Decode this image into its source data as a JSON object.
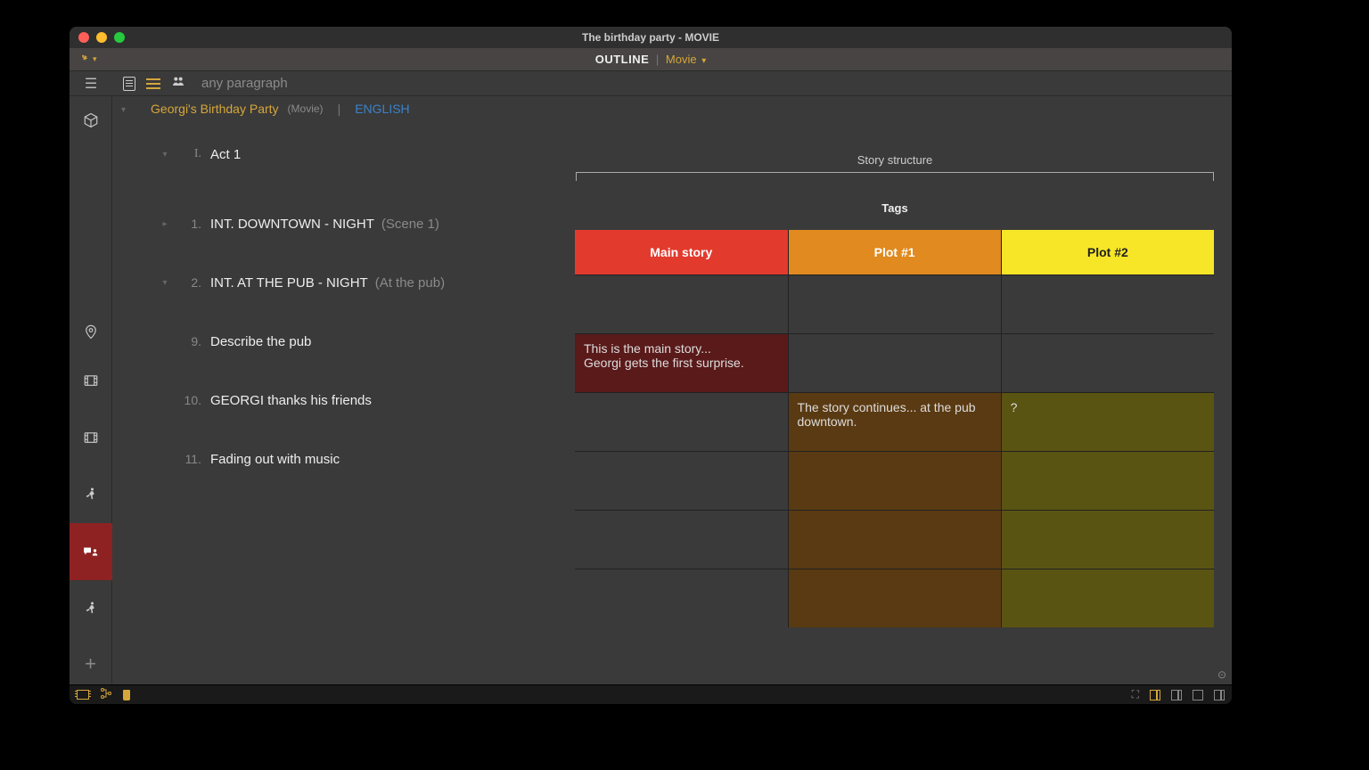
{
  "window": {
    "title": "The birthday party - MOVIE"
  },
  "modebar": {
    "run_icon": "run",
    "mode": "OUTLINE",
    "context": "Movie"
  },
  "toolrow": {
    "search_placeholder": "any paragraph"
  },
  "breadcrumb": {
    "project": "Georgi's Birthday Party",
    "type_label": "(Movie)",
    "separator": "|",
    "language": "ENGLISH"
  },
  "structure_label": "Story structure",
  "tags_label": "Tags",
  "columns": [
    {
      "label": "Main story",
      "color": "#e23b2e"
    },
    {
      "label": "Plot #1",
      "color": "#e08a1f"
    },
    {
      "label": "Plot #2",
      "color": "#f7e627"
    }
  ],
  "rows": [
    {
      "num": "I.",
      "num_style": "roman",
      "chevron": "down",
      "text": "Act 1",
      "suffix": "",
      "cells": [
        "",
        "",
        ""
      ],
      "shades": [
        "",
        "",
        ""
      ]
    },
    {
      "num": "1.",
      "chevron": "right",
      "text": "INT.  DOWNTOWN - NIGHT",
      "suffix": "(Scene 1)",
      "cells": [
        "This is the main story...\nGeorgi gets the first surprise.",
        "",
        ""
      ],
      "shades": [
        "cell-dark-red",
        "",
        ""
      ]
    },
    {
      "num": "2.",
      "chevron": "down",
      "text": "INT.  AT THE PUB - NIGHT",
      "suffix": "(At the pub)",
      "cells": [
        "",
        "The story continues... at the pub downtown.",
        "?"
      ],
      "shades": [
        "",
        "cell-brown",
        "cell-olive"
      ]
    },
    {
      "num": "9.",
      "chevron": "",
      "text": "Describe the pub",
      "suffix": "",
      "cells": [
        "",
        "",
        ""
      ],
      "shades": [
        "",
        "cell-brown",
        "cell-olive"
      ]
    },
    {
      "num": "10.",
      "chevron": "",
      "text": "GEORGI thanks his friends",
      "suffix": "",
      "cells": [
        "",
        "",
        ""
      ],
      "shades": [
        "",
        "cell-brown",
        "cell-olive"
      ]
    },
    {
      "num": "11.",
      "chevron": "",
      "text": "Fading out with music",
      "suffix": "",
      "cells": [
        "",
        "",
        ""
      ],
      "shades": [
        "",
        "cell-brown",
        "cell-olive"
      ]
    }
  ],
  "sidebar": {
    "items": [
      {
        "name": "cube-icon"
      },
      {
        "name": "map-pin-icon"
      },
      {
        "name": "film-icon"
      },
      {
        "name": "film-icon-2"
      },
      {
        "name": "run-icon"
      },
      {
        "name": "chat-user-icon",
        "active": true
      },
      {
        "name": "run-icon-2"
      },
      {
        "name": "add-icon"
      }
    ]
  }
}
